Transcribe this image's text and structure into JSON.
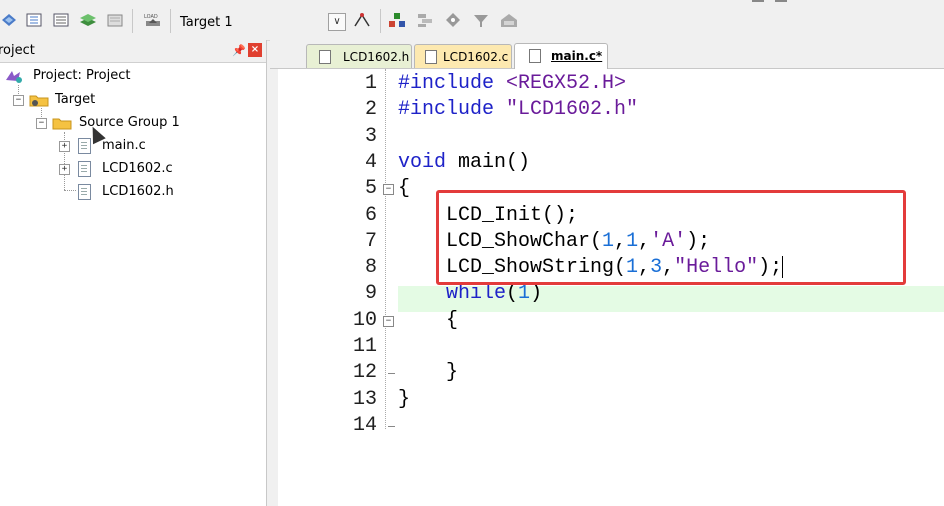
{
  "toolbar": {
    "icons": [
      "batch-build-icon",
      "rebuild-icon",
      "translate-icon",
      "stack-icon",
      "batch-icon",
      "load-icon",
      "options-icon",
      "manage-components-icon",
      "run-icon",
      "debug-icon",
      "settings-icon",
      "pack-icon"
    ],
    "target_label": "Target 1",
    "load_label": "LOAD"
  },
  "project_panel": {
    "title": "roject",
    "tree": {
      "project": "Project: Project",
      "target": "Target",
      "group": "Source Group 1",
      "files": [
        "main.c",
        "LCD1602.c",
        "LCD1602.h"
      ]
    }
  },
  "tabs": [
    {
      "label": "LCD1602.h",
      "active": false,
      "color": "#e8f0d4"
    },
    {
      "label": "LCD1602.c",
      "active": false,
      "color": "#fde9b0"
    },
    {
      "label": "main.c*",
      "active": true,
      "color": "#ffffff"
    }
  ],
  "editor": {
    "line_numbers": [
      "1",
      "2",
      "3",
      "4",
      "5",
      "6",
      "7",
      "8",
      "9",
      "10",
      "11",
      "12",
      "13",
      "14"
    ],
    "lines": {
      "l1_kw": "#include",
      "l1_rest": " <REGX52.H>",
      "l2_kw": "#include",
      "l2_rest": " \"LCD1602.h\"",
      "l4_kw": "void",
      "l4_rest": " main()",
      "l5": "{",
      "l6": "    LCD_Init();",
      "l7_a": "    LCD_ShowChar(",
      "l7_n1": "1",
      "l7_c1": ",",
      "l7_n2": "1",
      "l7_c2": ",",
      "l7_s": "'A'",
      "l7_end": ");",
      "l8_a": "    LCD_ShowString(",
      "l8_n1": "1",
      "l8_c1": ",",
      "l8_n2": "3",
      "l8_c2": ",",
      "l8_s": "\"Hello\"",
      "l8_end": ");",
      "l9_kw": "    while",
      "l9_a": "(",
      "l9_n": "1",
      "l9_b": ")",
      "l10": "    {",
      "l12": "    }",
      "l13": "}"
    },
    "highlight_color": "#e4fbe4",
    "annotation_color": "#e33b3b"
  }
}
